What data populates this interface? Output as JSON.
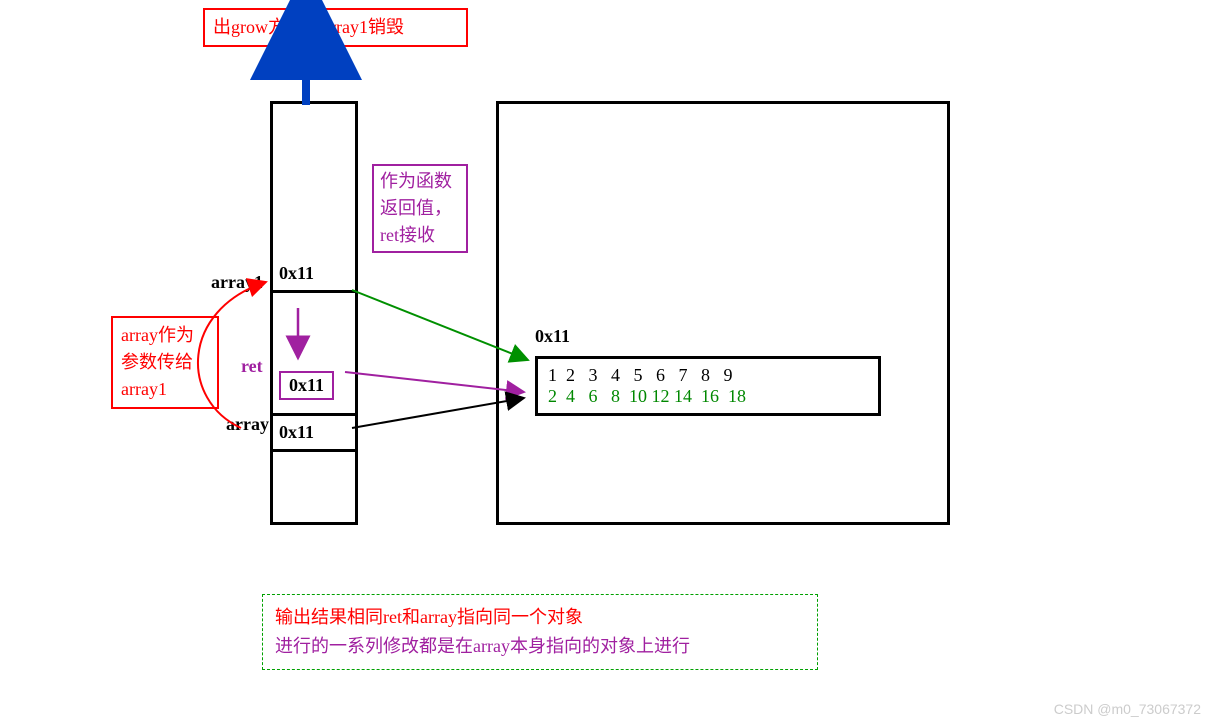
{
  "topBox": "出grow方法，array1销毁",
  "stack": {
    "array1Label": "array1",
    "array1Val": "0x11",
    "retLabel": "ret",
    "retVal": "0x11",
    "arrayLabel": "array",
    "arrayVal": "0x11"
  },
  "leftBox": {
    "line1": "array作为",
    "line2": "参数传给",
    "line3": "array1"
  },
  "retNote": {
    "line1": "作为函数",
    "line2": "返回值，",
    "line3": "ret接收"
  },
  "heap": {
    "addr": "0x11",
    "row1": "1  2   3   4   5   6   7   8   9",
    "row2": "2  4   6   8  10 12 14  16  18"
  },
  "bottom": {
    "line1": "输出结果相同ret和array指向同一个对象",
    "line2": "进行的一系列修改都是在array本身指向的对象上进行"
  },
  "watermark": "CSDN @m0_73067372"
}
